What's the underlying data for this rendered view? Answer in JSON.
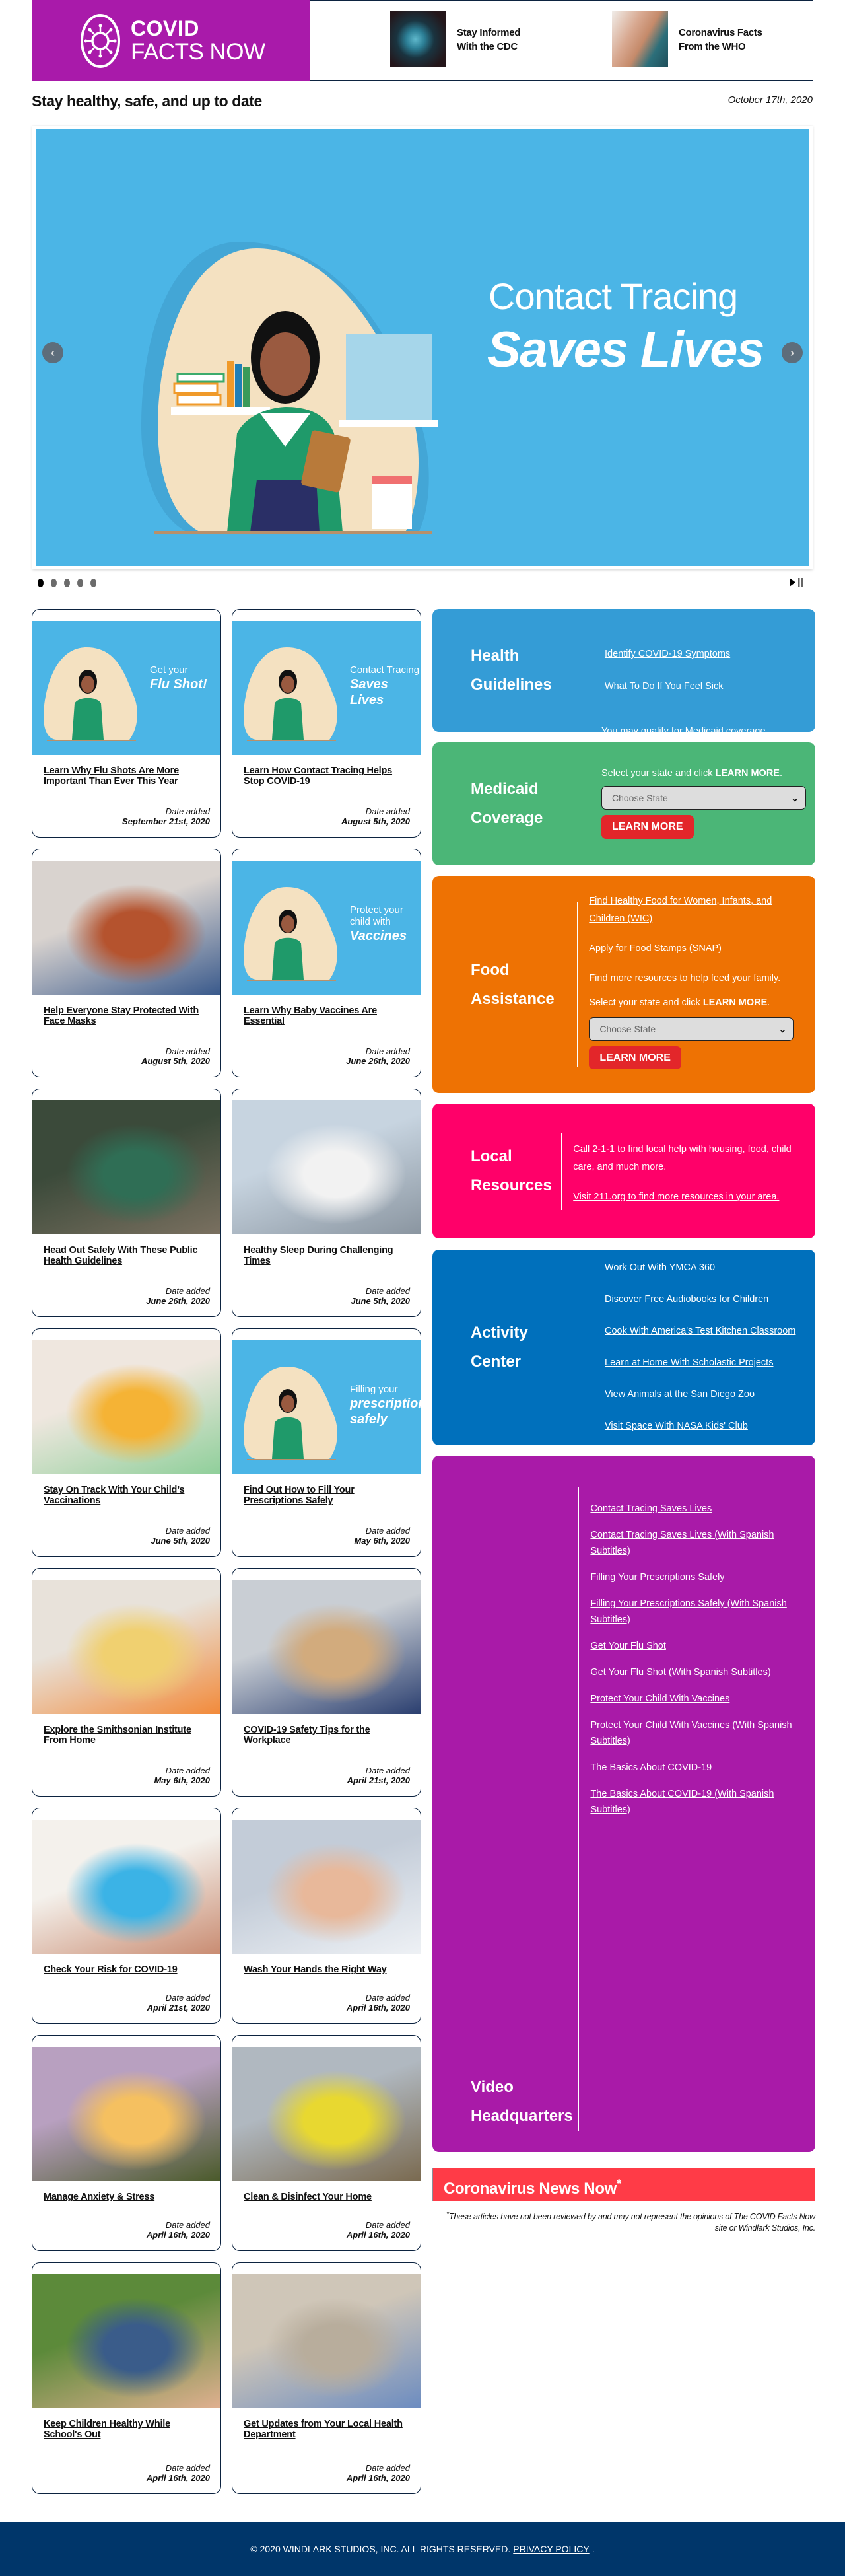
{
  "header": {
    "logo_line1": "COVID",
    "logo_line2": "FACTS NOW",
    "links": [
      {
        "label_line1": "Stay Informed",
        "label_line2": "With the CDC",
        "icon": "virus-photo"
      },
      {
        "label_line1": "Coronavirus Facts",
        "label_line2": "From the WHO",
        "icon": "handwashing-photo"
      }
    ]
  },
  "tagline": "Stay healthy, safe, and up to date",
  "date": "October 17th, 2020",
  "carousel": {
    "line1": "Contact Tracing",
    "line2": "Saves Lives",
    "slide_count": 5,
    "active_slide": 1,
    "prev_icon": "chevron-left-icon",
    "next_icon": "chevron-right-icon"
  },
  "date_added_label": "Date added",
  "cards": [
    {
      "title": "Learn Why Flu Shots Are More Important Than Ever This Year",
      "date": "September 21st, 2020",
      "image": {
        "kind": "illustration",
        "cap1": "Get your",
        "cap2": "Flu Shot!"
      }
    },
    {
      "title": "Learn How Contact Tracing Helps Stop COVID-19",
      "date": "August 5th, 2020",
      "image": {
        "kind": "illustration",
        "cap1": "Contact Tracing",
        "cap2": "Saves Lives"
      }
    },
    {
      "title": "Help Everyone Stay Protected With Face Masks",
      "date": "August 5th, 2020",
      "image": {
        "kind": "photo",
        "colors": [
          "#d9d3cf",
          "#b5532e",
          "#3a5a8c"
        ]
      }
    },
    {
      "title": "Learn Why Baby Vaccines Are Essential",
      "date": "June 26th, 2020",
      "image": {
        "kind": "illustration",
        "cap1": "Protect your child with",
        "cap2": "Vaccines"
      }
    },
    {
      "title": "Head Out Safely With These Public Health Guidelines",
      "date": "June 26th, 2020",
      "image": {
        "kind": "photo",
        "colors": [
          "#3b4a3a",
          "#2f6e55",
          "#7a7060"
        ]
      }
    },
    {
      "title": "Healthy Sleep During Challenging Times",
      "date": "June 5th, 2020",
      "image": {
        "kind": "photo",
        "colors": [
          "#c7d4e0",
          "#f2f2f2",
          "#8a95a0"
        ]
      }
    },
    {
      "title": "Stay On Track With Your Child’s Vaccinations",
      "date": "June 5th, 2020",
      "image": {
        "kind": "photo",
        "colors": [
          "#efe7df",
          "#f5b335",
          "#8fcf9a"
        ]
      }
    },
    {
      "title": "Find Out How to Fill Your Prescriptions Safely",
      "date": "May 6th, 2020",
      "image": {
        "kind": "illustration",
        "cap1": "Filling your",
        "cap2": "prescriptions safely"
      }
    },
    {
      "title": "Explore the Smithsonian Institute From Home",
      "date": "May 6th, 2020",
      "image": {
        "kind": "photo",
        "colors": [
          "#e8e2da",
          "#f0d070",
          "#f28a3a"
        ]
      }
    },
    {
      "title": "COVID-19 Safety Tips for the Workplace",
      "date": "April 21st, 2020",
      "image": {
        "kind": "photo",
        "colors": [
          "#c9ced4",
          "#d2ab7d",
          "#2b3f70"
        ]
      }
    },
    {
      "title": "Check Your Risk for COVID-19",
      "date": "April 21st, 2020",
      "image": {
        "kind": "photo",
        "colors": [
          "#f4f1ec",
          "#3bb3e6",
          "#c98c72"
        ]
      }
    },
    {
      "title": "Wash Your Hands the Right Way",
      "date": "April 16th, 2020",
      "image": {
        "kind": "photo",
        "colors": [
          "#c3ccd8",
          "#e8b89a",
          "#eef1f5"
        ]
      }
    },
    {
      "title": "Manage Anxiety & Stress",
      "date": "April 16th, 2020",
      "image": {
        "kind": "photo",
        "colors": [
          "#b8a0c0",
          "#f5c060",
          "#4a5a2a"
        ]
      }
    },
    {
      "title": "Clean & Disinfect Your Home",
      "date": "April 16th, 2020",
      "image": {
        "kind": "photo",
        "colors": [
          "#b0b8c0",
          "#e8d830",
          "#7a6a50"
        ]
      }
    },
    {
      "title": "Keep Children Healthy While School's Out",
      "date": "April 16th, 2020",
      "image": {
        "kind": "photo",
        "colors": [
          "#5c8a3a",
          "#3a5c8a",
          "#e0b090"
        ]
      }
    },
    {
      "title": "Get Updates from Your Local Health Department",
      "date": "April 16th, 2020",
      "image": {
        "kind": "photo",
        "colors": [
          "#cfc6b8",
          "#b8ad9c",
          "#6c8cc0"
        ]
      }
    }
  ],
  "panels": {
    "health": {
      "title_line1": "Health",
      "title_line2": "Guidelines",
      "color": "#349cd6",
      "links": [
        "Identify COVID-19 Symptoms",
        "What To Do If You Feel Sick"
      ]
    },
    "medicaid": {
      "title_line1": "Medicaid",
      "title_line2": "Coverage",
      "color": "#4bb677",
      "text1": "You may qualify for Medicaid coverage.",
      "text2_pre": "Select your state and click ",
      "text2_bold": "LEARN MORE",
      "text2_post": ".",
      "select_placeholder": "Choose State",
      "button": "LEARN MORE"
    },
    "food": {
      "title_line1": "Food",
      "title_line2": "Assistance",
      "color": "#ee7203",
      "links": [
        "Find Healthy Food for Women, Infants, and Children (WIC)",
        "Apply for Food Stamps (SNAP)"
      ],
      "text1": "Find more resources to help feed your family.",
      "text2_pre": "Select your state and click ",
      "text2_bold": "LEARN MORE",
      "text2_post": ".",
      "select_placeholder": "Choose State",
      "button": "LEARN MORE"
    },
    "local": {
      "title_line1": "Local",
      "title_line2": "Resources",
      "color": "#ff0069",
      "text1": "Call 2-1-1 to find local help with housing, food, child care, and much more.",
      "link": "Visit 211.org to find more resources in your area."
    },
    "activity": {
      "title_line1": "Activity",
      "title_line2": "Center",
      "color": "#0070bc",
      "links": [
        "Work Out With YMCA 360",
        "Discover Free Audiobooks for Children",
        "Cook With America's Test Kitchen Classroom",
        "Learn at Home With Scholastic Projects",
        "View Animals at the San Diego Zoo",
        "Visit Space With NASA Kids' Club"
      ]
    },
    "video": {
      "title_line1": "Video",
      "title_line2": "Headquarters",
      "color": "#a91aa8",
      "links": [
        "Contact Tracing Saves Lives",
        "Contact Tracing Saves Lives (With Spanish Subtitles)",
        "Filling Your Prescriptions Safely",
        "Filling Your Prescriptions Safely (With Spanish Subtitles)",
        "Get Your Flu Shot",
        "Get Your Flu Shot (With Spanish Subtitles)",
        "Protect Your Child With Vaccines",
        "Protect Your Child With Vaccines (With Spanish Subtitles)",
        "The Basics About COVID-19",
        "The Basics About COVID-19 (With Spanish Subtitles)"
      ]
    }
  },
  "news": {
    "title": "Coronavirus News Now",
    "marker": "*",
    "color": "#ff3b47",
    "disclaimer_marker": "*",
    "disclaimer": "These articles have not been reviewed by and may not represent the opinions of The COVID Facts Now site or Windlark Studios, Inc."
  },
  "footer": {
    "copyright": "© 2020 WINDLARK STUDIOS, INC. ALL RIGHTS RESERVED.",
    "privacy": "PRIVACY POLICY",
    "period": "."
  }
}
